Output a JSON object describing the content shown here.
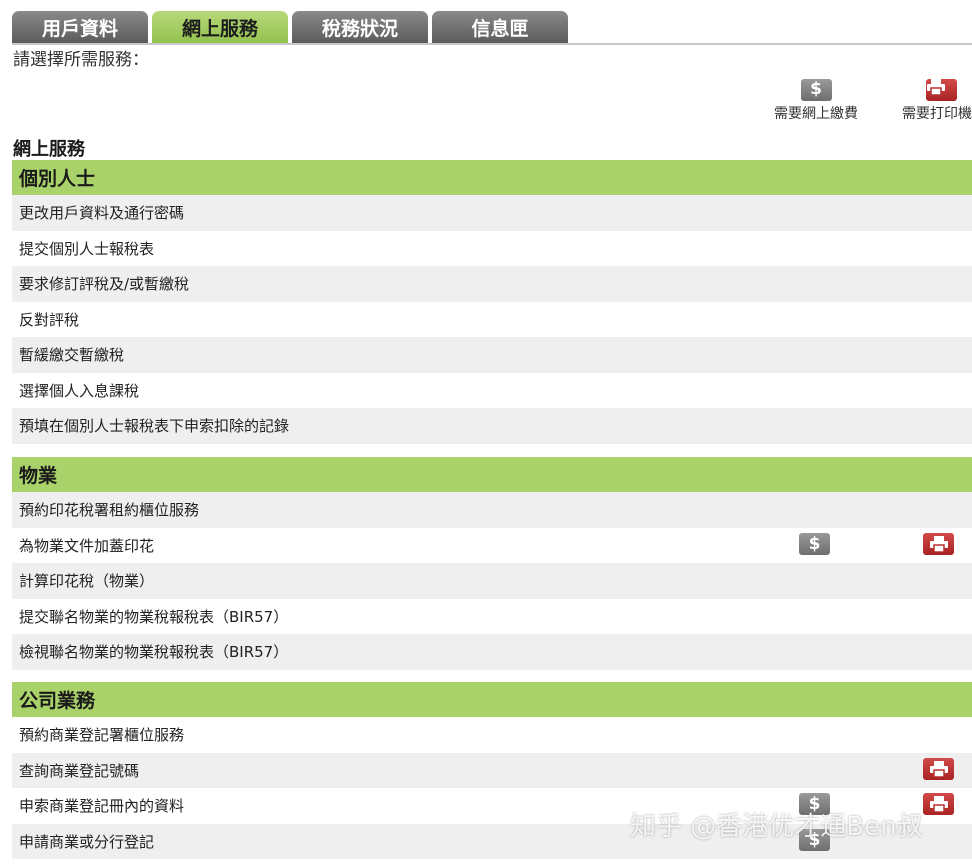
{
  "tabs": [
    {
      "label": "用戶資料",
      "active": false
    },
    {
      "label": "網上服務",
      "active": true
    },
    {
      "label": "稅務狀況",
      "active": false
    },
    {
      "label": "信息匣",
      "active": false
    }
  ],
  "prompt": "請選擇所需服務：",
  "legend": {
    "pay_label": "需要網上繳費",
    "print_label": "需要打印機"
  },
  "section_title": "網上服務",
  "groups": [
    {
      "title": "個別人士",
      "items": [
        {
          "label": "更改用戶資料及通行密碼"
        },
        {
          "label": "提交個別人士報稅表"
        },
        {
          "label": "要求修訂評稅及/或暫繳稅"
        },
        {
          "label": "反對評稅"
        },
        {
          "label": "暫緩繳交暫繳稅"
        },
        {
          "label": "選擇個人入息課稅"
        },
        {
          "label": "預填在個別人士報稅表下申索扣除的記錄"
        }
      ]
    },
    {
      "title": "物業",
      "items": [
        {
          "label": "預約印花稅署租約櫃位服務"
        },
        {
          "label": "為物業文件加蓋印花",
          "pay": true,
          "print": true
        },
        {
          "label": "計算印花稅（物業）"
        },
        {
          "label": "提交聯名物業的物業稅報稅表（BIR57）"
        },
        {
          "label": "檢視聯名物業的物業稅報稅表（BIR57）"
        }
      ]
    },
    {
      "title": "公司業務",
      "items": [
        {
          "label": "預約商業登記署櫃位服務"
        },
        {
          "label": "查詢商業登記號碼",
          "print": true
        },
        {
          "label": "申索商業登記冊內的資料",
          "pay": true,
          "print": true
        },
        {
          "label": "申請商業或分行登記",
          "pay": true
        }
      ]
    }
  ],
  "watermark": "知乎 @香港优才通Ben叔",
  "colors": {
    "tab_active": "#a9d26a",
    "tab_inactive": "#6b6b6b",
    "group_header": "#a9d26a",
    "row_alt": "#efefef",
    "pay_icon": "#7d7d7d",
    "print_icon": "#b83030"
  }
}
